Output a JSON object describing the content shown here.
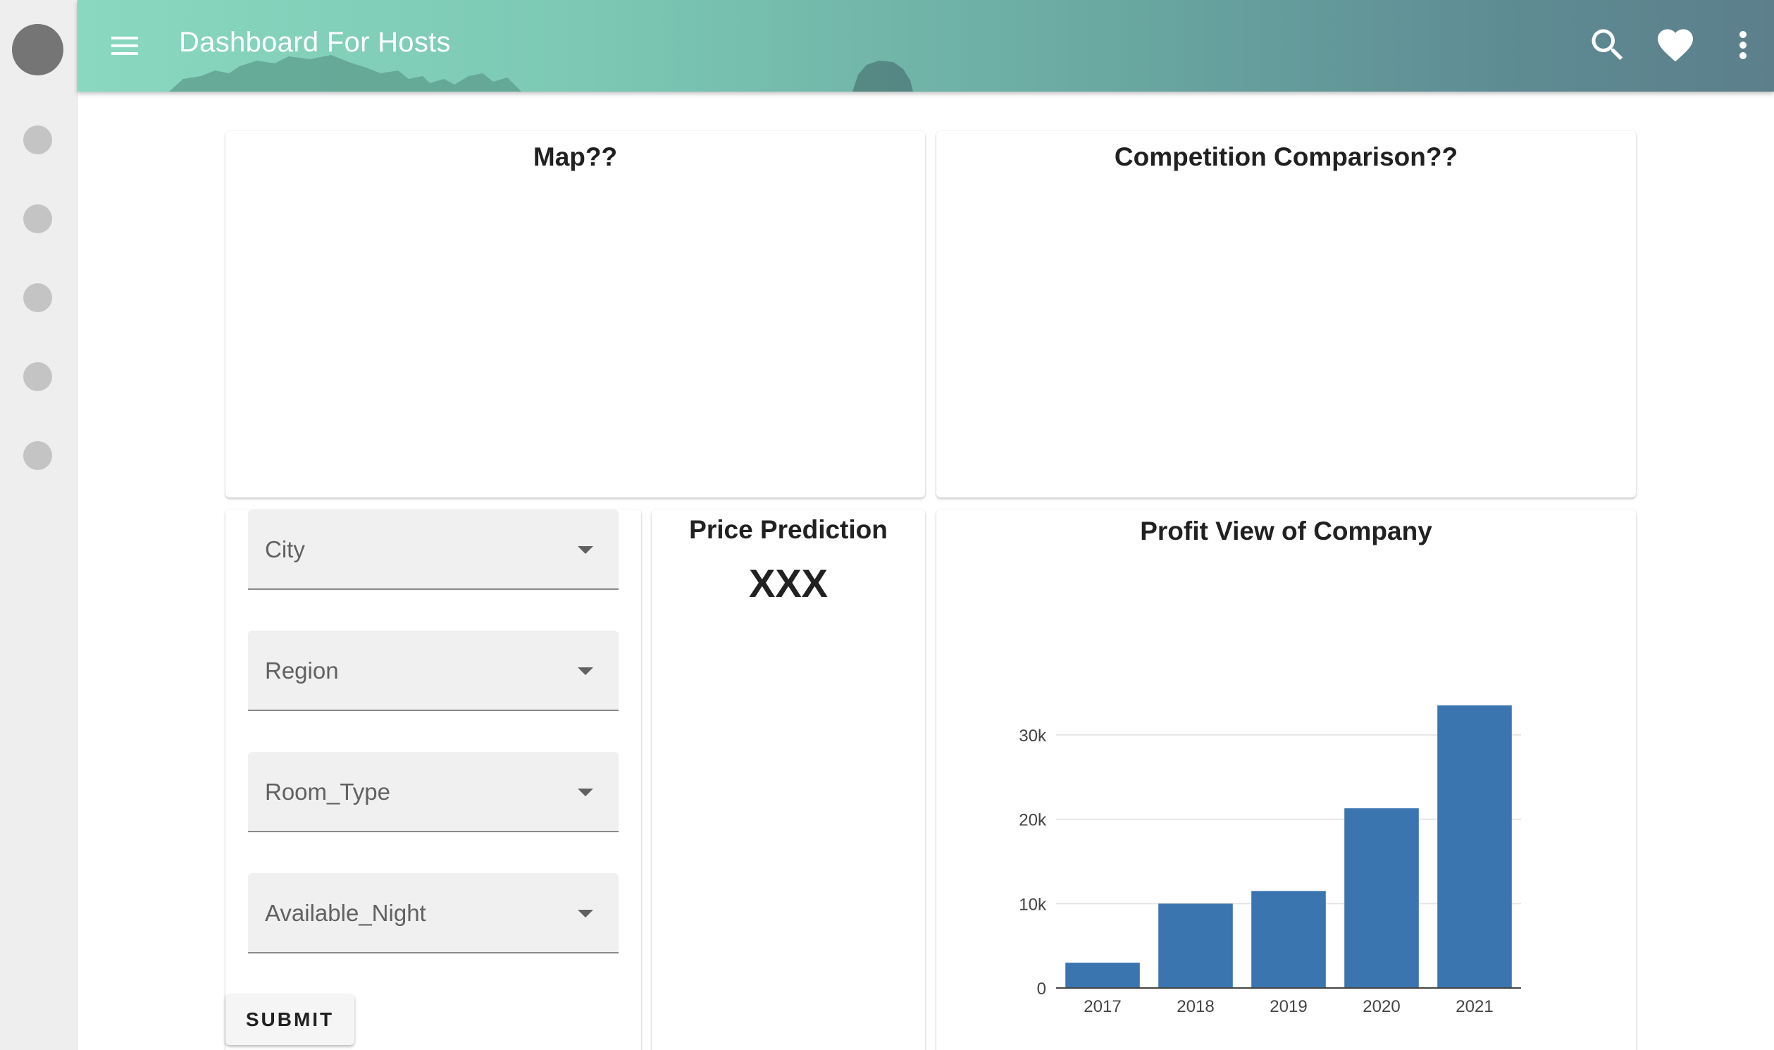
{
  "app": {
    "title": "Dashboard For Hosts",
    "accent": "#6aa9a2",
    "icons": [
      "menu-icon",
      "search-icon",
      "heart-icon",
      "more-vert-icon"
    ]
  },
  "cards": {
    "map_title": "Map??",
    "competition_title": "Competition Comparison??",
    "price_title": "Price Prediction",
    "price_value": "XXX",
    "profit_title": "Profit View of Company"
  },
  "filters": {
    "city": "City",
    "region": "Region",
    "room_type": "Room_Type",
    "available_night": "Available_Night",
    "submit": "SUBMIT"
  },
  "chart_data": {
    "type": "bar",
    "title": "Profit View of Company",
    "categories": [
      "2017",
      "2018",
      "2019",
      "2020",
      "2021"
    ],
    "values": [
      3000,
      10000,
      11500,
      21300,
      33500
    ],
    "ylim": [
      0,
      33500
    ],
    "yticks": [
      0,
      10000,
      20000,
      30000
    ],
    "ytick_labels": [
      "0",
      "10k",
      "20k",
      "30k"
    ],
    "grid": true,
    "bar_color": "#3a75b0"
  }
}
